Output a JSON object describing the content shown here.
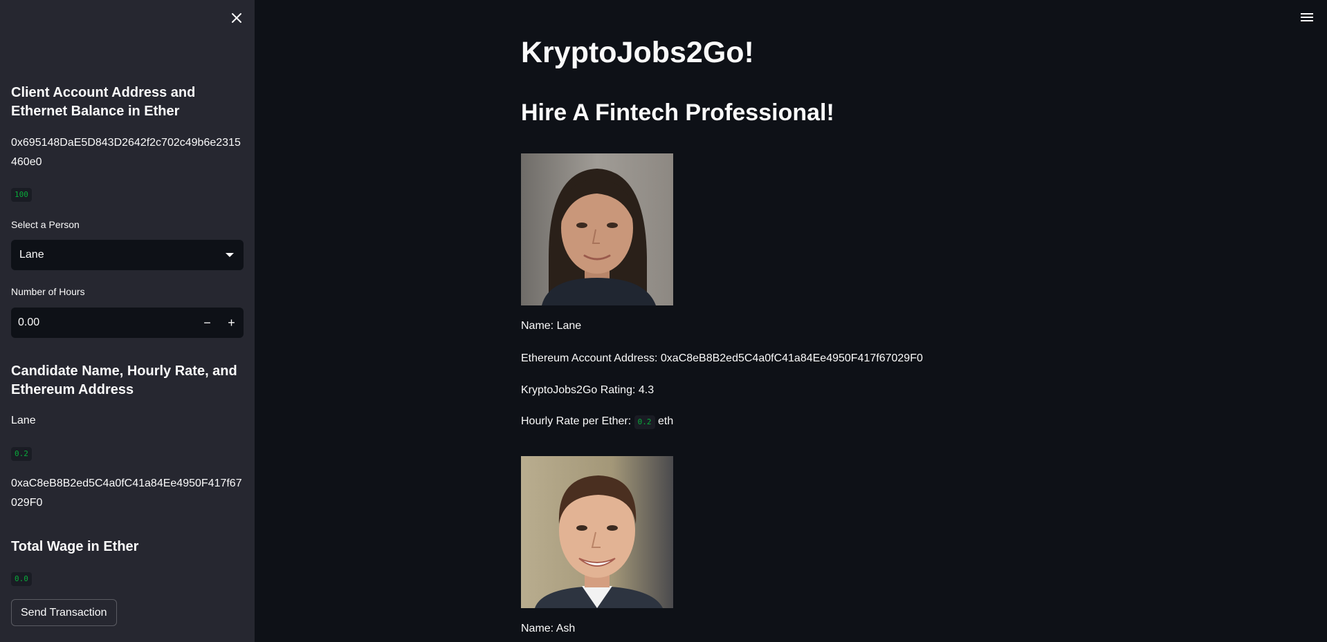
{
  "sidebar": {
    "client_heading": "Client Account Address and Ethernet Balance in Ether",
    "client_address": "0x695148DaE5D843D2642f2c702c49b6e2315460e0",
    "client_balance": "100",
    "select_label": "Select a Person",
    "select_value": "Lane",
    "hours_label": "Number of Hours",
    "hours_value": "0.00",
    "decrement_symbol": "−",
    "increment_symbol": "+",
    "candidate_heading": "Candidate Name, Hourly Rate, and Ethereum Address",
    "candidate_name": "Lane",
    "candidate_rate": "0.2",
    "candidate_address": "0xaC8eB8B2ed5C4a0fC41a84Ee4950F417f67029F0",
    "wage_heading": "Total Wage in Ether",
    "wage_value": "0.0",
    "send_button": "Send Transaction"
  },
  "main": {
    "title": "KryptoJobs2Go!",
    "subtitle": "Hire A Fintech Professional!",
    "candidates": [
      {
        "name_line": "Name: Lane",
        "address_line": "Ethereum Account Address: 0xaC8eB8B2ed5C4a0fC41a84Ee4950F417f67029F0",
        "rating_line": "KryptoJobs2Go Rating: 4.3",
        "rate_prefix": "Hourly Rate per Ether:",
        "rate_value": "0.2",
        "rate_suffix": "eth"
      },
      {
        "name_line": "Name: Ash"
      }
    ]
  },
  "colors": {
    "sidebar_bg": "#262730",
    "main_bg": "#0e1117",
    "code_text": "#09ab3b"
  },
  "icons": {
    "sidebar_close": "close-icon",
    "main_menu": "hamburger-menu-icon",
    "select_caret": "chevron-down-icon"
  }
}
